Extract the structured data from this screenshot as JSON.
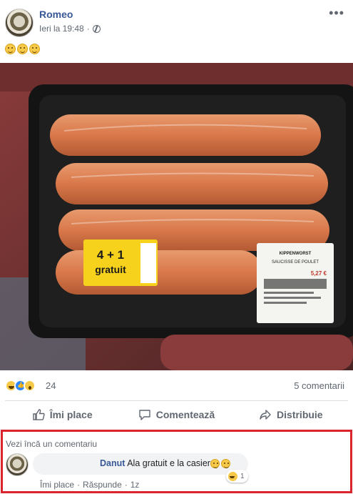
{
  "post": {
    "author": "Romeo",
    "timestamp": "Ieri la 19:48",
    "privacy_icon": "globe-icon",
    "body_emojis": [
      "grinning-face-emoji",
      "grinning-face-emoji",
      "grinning-face-emoji"
    ]
  },
  "photo": {
    "deal_text_top": "4 + 1",
    "deal_text_bottom": "gratuit",
    "label_title": "KIPPENWORST",
    "label_subtitle": "SAUCISSE DE POULET",
    "label_price": "5,27 €"
  },
  "reactions": {
    "icons": [
      "haha-icon",
      "like-icon",
      "wow-icon"
    ],
    "count": "24",
    "comments": "5 comentarii"
  },
  "actions": {
    "like": "Îmi place",
    "comment": "Comentează",
    "share": "Distribuie"
  },
  "comments": {
    "more_label": "Vezi încă un comentariu",
    "items": [
      {
        "author": "Danut",
        "text": "Ala gratuit e la casier",
        "reaction_count": "1",
        "like_label": "Îmi place",
        "reply_label": "Răspunde",
        "age": "1z"
      }
    ]
  },
  "colors": {
    "link_blue": "#385898",
    "highlight_red": "#d9232d",
    "sausage_orange": "#d9784a"
  }
}
